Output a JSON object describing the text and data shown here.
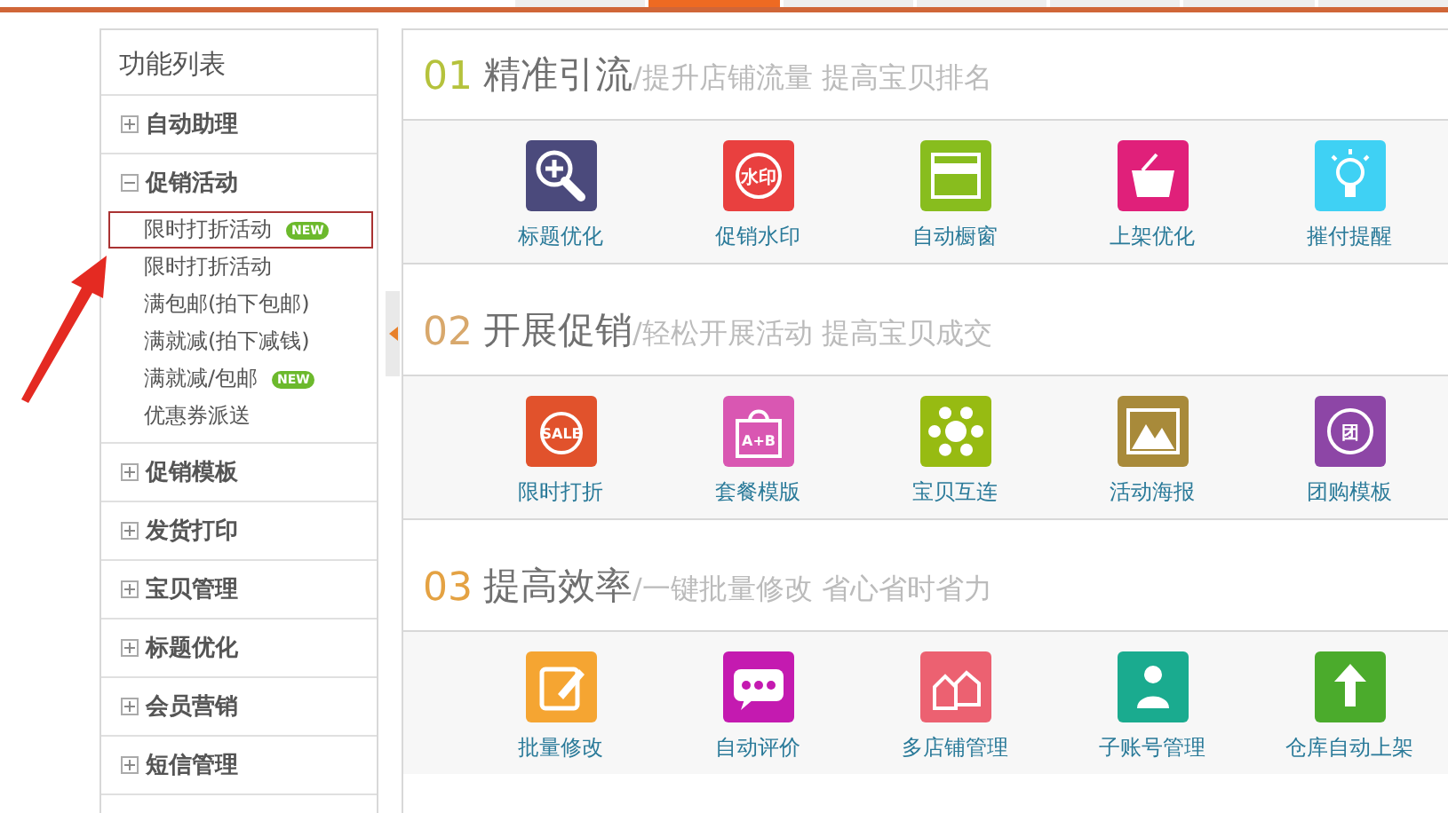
{
  "top_tabs": [
    {
      "selected": false
    },
    {
      "selected": true
    },
    {
      "selected": false
    },
    {
      "selected": false
    },
    {
      "selected": false
    },
    {
      "selected": false
    },
    {
      "selected": false
    }
  ],
  "sidebar": {
    "title": "功能列表",
    "groups": [
      {
        "label": "自动助理",
        "expanded": false
      },
      {
        "label": "促销活动",
        "expanded": true,
        "children": [
          {
            "label": "限时打折活动",
            "selected": true,
            "badge": "NEW"
          },
          {
            "label": "限时打折活动",
            "selected": false
          },
          {
            "label": "满包邮(拍下包邮)",
            "selected": false
          },
          {
            "label": "满就减(拍下减钱)",
            "selected": false
          },
          {
            "label": "满就减/包邮",
            "selected": false,
            "badge": "NEW"
          },
          {
            "label": "优惠券派送",
            "selected": false
          }
        ]
      },
      {
        "label": "促销模板",
        "expanded": false
      },
      {
        "label": "发货打印",
        "expanded": false
      },
      {
        "label": "宝贝管理",
        "expanded": false
      },
      {
        "label": "标题优化",
        "expanded": false
      },
      {
        "label": "会员营销",
        "expanded": false
      },
      {
        "label": "短信管理",
        "expanded": false
      }
    ]
  },
  "sections": [
    {
      "number": "01",
      "color": "#b5c23c",
      "title": "精准引流",
      "subtitle": "/提升店铺流量 提高宝贝排名",
      "tools": [
        {
          "label": "标题优化",
          "color": "#4b4a7c"
        },
        {
          "label": "促销水印",
          "color": "#e9403f",
          "icon_text": "水印"
        },
        {
          "label": "自动橱窗",
          "color": "#88bd1e"
        },
        {
          "label": "上架优化",
          "color": "#e0207a"
        },
        {
          "label": "摧付提醒",
          "color": "#3fd1f4"
        }
      ]
    },
    {
      "number": "02",
      "color": "#d8a86c",
      "title": "开展促销",
      "subtitle": "/轻松开展活动 提高宝贝成交",
      "tools": [
        {
          "label": "限时打折",
          "color": "#e1522c",
          "icon_text": "SALE"
        },
        {
          "label": "套餐模版",
          "color": "#d957b2",
          "icon_text": "A+B"
        },
        {
          "label": "宝贝互连",
          "color": "#97bb12"
        },
        {
          "label": "活动海报",
          "color": "#a88a3a"
        },
        {
          "label": "团购模板",
          "color": "#8d46a6",
          "icon_text": "团"
        }
      ]
    },
    {
      "number": "03",
      "color": "#e4a243",
      "title": "提高效率",
      "subtitle": "/一键批量修改 省心省时省力",
      "tools": [
        {
          "label": "批量修改",
          "color": "#f5a532"
        },
        {
          "label": "自动评价",
          "color": "#c41ab0"
        },
        {
          "label": "多店铺管理",
          "color": "#ec6171"
        },
        {
          "label": "子账号管理",
          "color": "#1aab8f"
        },
        {
          "label": "仓库自动上架",
          "color": "#4bab2c"
        }
      ]
    }
  ]
}
